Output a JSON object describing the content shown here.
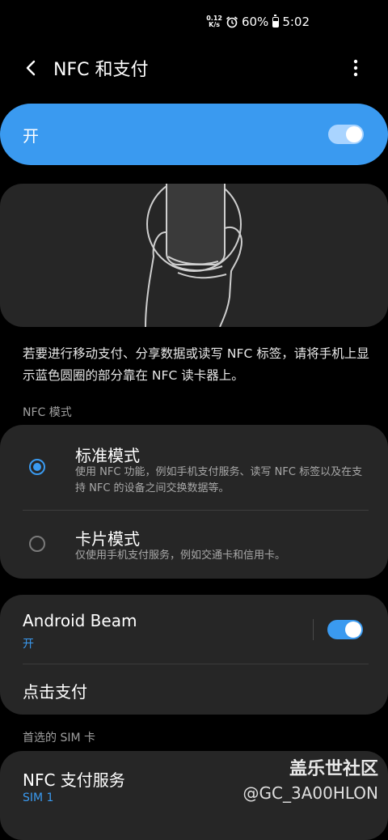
{
  "status_bar": {
    "net_speed_value": "0.12",
    "net_speed_unit": "K/s",
    "battery": "60%",
    "battery_level": 0.6,
    "time": "5:02",
    "icons": [
      "alarm-icon",
      "battery-icon"
    ]
  },
  "app_bar": {
    "title": "NFC 和支付",
    "icons": [
      "back-arrow-icon",
      "more-options-icon"
    ]
  },
  "master_switch": {
    "label": "开",
    "state": "on"
  },
  "description": "若要进行移动支付、分享数据或读写 NFC 标签，请将手机上显示蓝色圆圈的部分靠在 NFC 读卡器上。",
  "nfc_mode": {
    "header": "NFC 模式",
    "options": [
      {
        "title": "标准模式",
        "subtitle": "使用 NFC 功能，例如手机支付服务、读写 NFC 标签以及在支持 NFC 的设备之间交换数据等。",
        "selected": true
      },
      {
        "title": "卡片模式",
        "subtitle": "仅使用手机支付服务，例如交通卡和信用卡。",
        "selected": false
      }
    ]
  },
  "beam_card": {
    "android_beam": {
      "title": "Android Beam",
      "status": "开",
      "state": "on"
    },
    "tap_pay": {
      "title": "点击支付"
    }
  },
  "sim": {
    "header": "首选的 SIM 卡",
    "item": {
      "title": "NFC 支付服务",
      "subtitle": "SIM 1"
    }
  },
  "watermark": {
    "line1": "盖乐世社区",
    "line2": "@GC_3A00HLON"
  },
  "colors": {
    "accent": "#3a9af0",
    "background": "#000000",
    "card": "#262626"
  }
}
